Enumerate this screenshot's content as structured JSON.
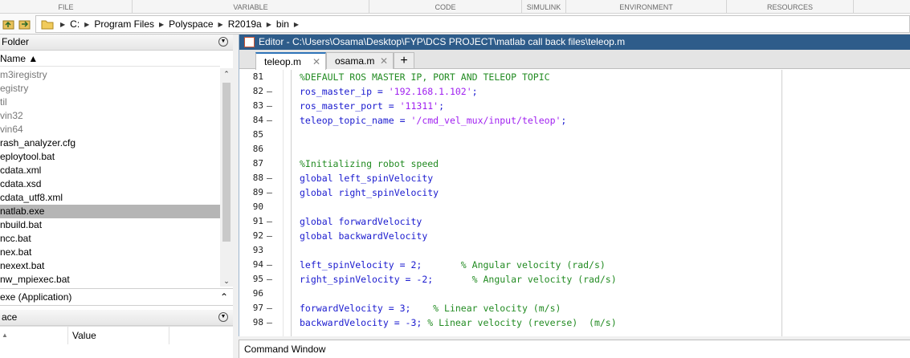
{
  "ribbon": {
    "sections": [
      "FILE",
      "VARIABLE",
      "CODE",
      "SIMULINK",
      "ENVIRONMENT",
      "RESOURCES"
    ]
  },
  "address": {
    "crumbs": [
      "C:",
      "Program Files",
      "Polyspace",
      "R2019a",
      "bin"
    ]
  },
  "folder_panel": {
    "title": "Folder",
    "column_name": "Name ▲",
    "items": [
      {
        "label": "m3iregistry",
        "style": "gray"
      },
      {
        "label": "egistry",
        "style": "gray"
      },
      {
        "label": "til",
        "style": "gray"
      },
      {
        "label": "vin32",
        "style": "gray"
      },
      {
        "label": "vin64",
        "style": "gray"
      },
      {
        "label": "rash_analyzer.cfg",
        "style": "normal"
      },
      {
        "label": "eploytool.bat",
        "style": "normal"
      },
      {
        "label": "cdata.xml",
        "style": "normal"
      },
      {
        "label": "cdata.xsd",
        "style": "normal"
      },
      {
        "label": "cdata_utf8.xml",
        "style": "normal"
      },
      {
        "label": "natlab.exe",
        "style": "selected"
      },
      {
        "label": "nbuild.bat",
        "style": "normal"
      },
      {
        "label": "ncc.bat",
        "style": "normal"
      },
      {
        "label": "nex.bat",
        "style": "normal"
      },
      {
        "label": "nexext.bat",
        "style": "normal"
      },
      {
        "label": "nw_mpiexec.bat",
        "style": "normal"
      }
    ],
    "details_label": "exe  (Application)"
  },
  "workspace": {
    "title": "ace",
    "col_name": "▲",
    "col_value": "Value"
  },
  "editor": {
    "title": "Editor - C:\\Users\\Osama\\Desktop\\FYP\\DCS PROJECT\\matlab call back files\\teleop.m",
    "tabs": [
      {
        "label": "teleop.m",
        "active": true
      },
      {
        "label": "osama.m",
        "active": false
      }
    ],
    "lines": [
      {
        "n": "81",
        "dash": "",
        "parts": [
          {
            "t": "%DEFAULT ROS MASTER IP, PORT AND TELEOP TOPIC",
            "c": "cm"
          }
        ]
      },
      {
        "n": "82",
        "dash": "–",
        "parts": [
          {
            "t": "ros_master_ip = ",
            "c": "kw"
          },
          {
            "t": "'192.168.1.102'",
            "c": "st"
          },
          {
            "t": ";",
            "c": "kw"
          }
        ]
      },
      {
        "n": "83",
        "dash": "–",
        "parts": [
          {
            "t": "ros_master_port = ",
            "c": "kw"
          },
          {
            "t": "'11311'",
            "c": "st"
          },
          {
            "t": ";",
            "c": "kw"
          }
        ]
      },
      {
        "n": "84",
        "dash": "–",
        "parts": [
          {
            "t": "teleop_topic_name = ",
            "c": "kw"
          },
          {
            "t": "'/cmd_vel_mux/input/teleop'",
            "c": "st"
          },
          {
            "t": ";",
            "c": "kw"
          }
        ]
      },
      {
        "n": "85",
        "dash": "",
        "parts": []
      },
      {
        "n": "86",
        "dash": "",
        "parts": []
      },
      {
        "n": "87",
        "dash": "",
        "parts": [
          {
            "t": "%Initializing robot speed",
            "c": "cm"
          }
        ]
      },
      {
        "n": "88",
        "dash": "–",
        "parts": [
          {
            "t": "global ",
            "c": "kw"
          },
          {
            "t": "left_spinVelocity",
            "c": "kw"
          }
        ]
      },
      {
        "n": "89",
        "dash": "–",
        "parts": [
          {
            "t": "global ",
            "c": "kw"
          },
          {
            "t": "right_spinVelocity",
            "c": "kw"
          }
        ]
      },
      {
        "n": "90",
        "dash": "",
        "parts": []
      },
      {
        "n": "91",
        "dash": "–",
        "parts": [
          {
            "t": "global ",
            "c": "kw"
          },
          {
            "t": "forwardVelocity",
            "c": "kw"
          }
        ]
      },
      {
        "n": "92",
        "dash": "–",
        "parts": [
          {
            "t": "global ",
            "c": "kw"
          },
          {
            "t": "backwardVelocity",
            "c": "kw"
          }
        ]
      },
      {
        "n": "93",
        "dash": "",
        "parts": []
      },
      {
        "n": "94",
        "dash": "–",
        "parts": [
          {
            "t": "left_spinVelocity = 2;       ",
            "c": "kw"
          },
          {
            "t": "% Angular velocity (rad/s)",
            "c": "cm"
          }
        ]
      },
      {
        "n": "95",
        "dash": "–",
        "parts": [
          {
            "t": "right_spinVelocity = -2;       ",
            "c": "kw"
          },
          {
            "t": "% Angular velocity (rad/s)",
            "c": "cm"
          }
        ]
      },
      {
        "n": "96",
        "dash": "",
        "parts": []
      },
      {
        "n": "97",
        "dash": "–",
        "parts": [
          {
            "t": "forwardVelocity = 3;    ",
            "c": "kw"
          },
          {
            "t": "% Linear velocity (m/s)",
            "c": "cm"
          }
        ]
      },
      {
        "n": "98",
        "dash": "–",
        "parts": [
          {
            "t": "backwardVelocity = -3; ",
            "c": "kw"
          },
          {
            "t": "% Linear velocity (reverse)  (m/s)",
            "c": "cm"
          }
        ]
      }
    ]
  },
  "command_window": {
    "title": "Command Window"
  },
  "colors": {
    "keyword": "#1a1acf",
    "comment": "#228b22",
    "string": "#a020f0",
    "editor_title_bg": "#2e5c8a"
  }
}
